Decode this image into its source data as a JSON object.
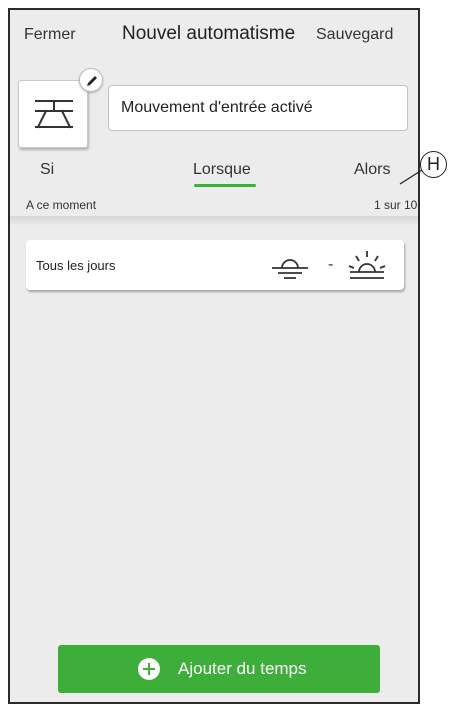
{
  "header": {
    "close_label": "Fermer",
    "title": "Nouvel automatisme",
    "save_label": "Sauvegard"
  },
  "automation": {
    "name_value": "Mouvement d'entrée activé",
    "icon": "shutter-icon",
    "edit_icon": "pencil-icon"
  },
  "tabs": [
    {
      "label": "Si"
    },
    {
      "label": "Lorsque",
      "selected": true
    },
    {
      "label": "Alors"
    }
  ],
  "callout": {
    "label": "H"
  },
  "section": {
    "title": "A ce moment",
    "counter": "1 sur 10"
  },
  "time_rows": [
    {
      "label": "Tous les jours",
      "start_icon": "sunset-icon",
      "separator": "-",
      "end_icon": "sunrise-icon"
    }
  ],
  "add_button": {
    "label": "Ajouter du temps",
    "icon": "plus-circle-icon"
  },
  "colors": {
    "accent": "#3dae3a",
    "background": "#ececec",
    "card": "#ffffff"
  }
}
